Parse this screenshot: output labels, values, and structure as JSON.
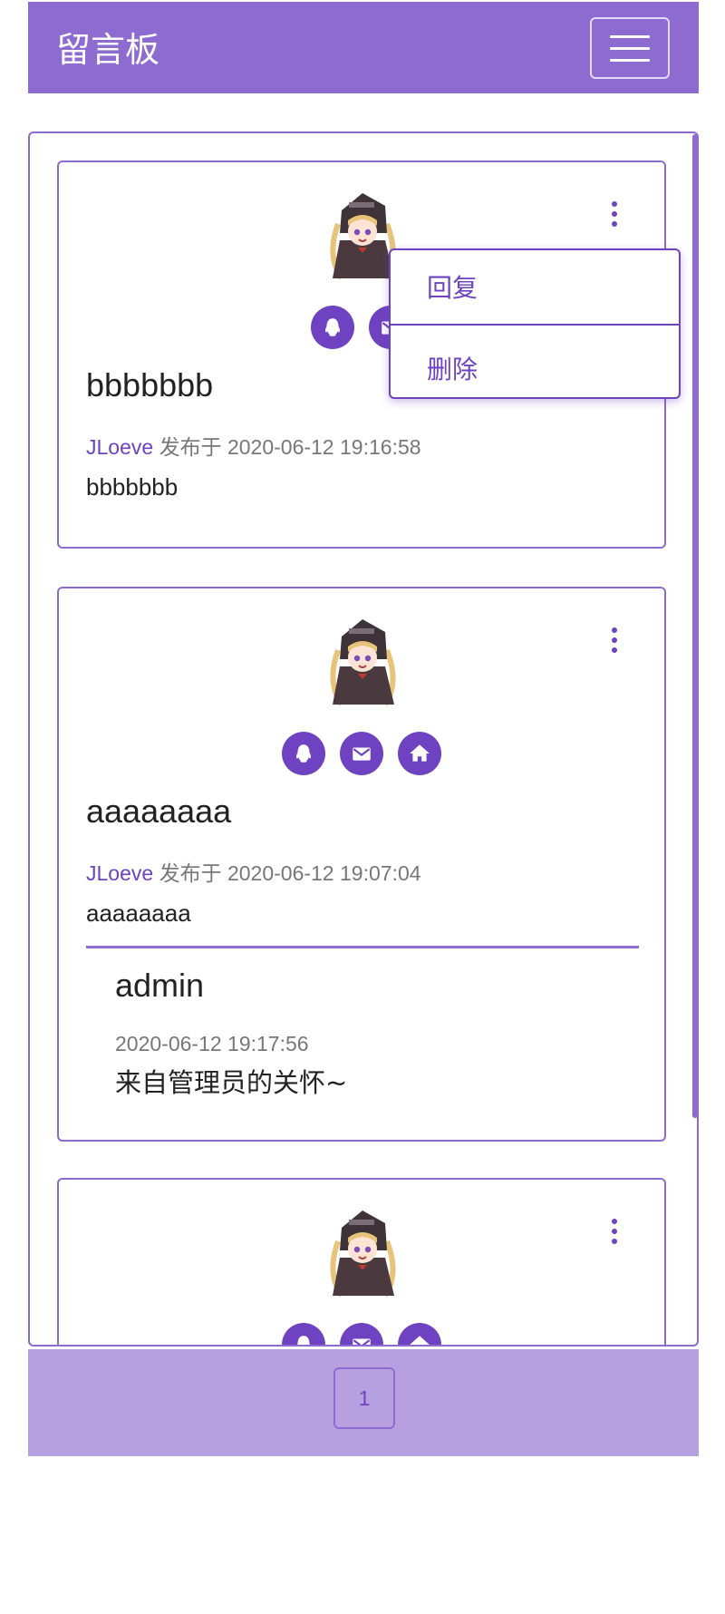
{
  "navbar": {
    "brand": "留言板"
  },
  "colors": {
    "primary": "#6f42c1",
    "navbar_bg": "#8e6bd1",
    "footer_bg": "#b7a0e0"
  },
  "messages": [
    {
      "title": "bbbbbbb",
      "author": "JLoeve",
      "posted_label": "发布于",
      "time": "2020-06-12 19:16:58",
      "body": "bbbbbbb",
      "contact_icons": [
        "qq-icon",
        "mail-icon"
      ]
    },
    {
      "title": "aaaaaaaa",
      "author": "JLoeve",
      "posted_label": "发布于",
      "time": "2020-06-12 19:07:04",
      "body": "aaaaaaaa",
      "contact_icons": [
        "qq-icon",
        "mail-icon",
        "home-icon"
      ],
      "reply": {
        "name": "admin",
        "time": "2020-06-12 19:17:56",
        "text": "来自管理员的关怀~"
      }
    },
    {
      "contact_icons": [
        "qq-icon",
        "mail-icon",
        "home-icon"
      ]
    }
  ],
  "dropdown": {
    "reply": "回复",
    "delete": "删除"
  },
  "pagination": {
    "current": "1"
  }
}
